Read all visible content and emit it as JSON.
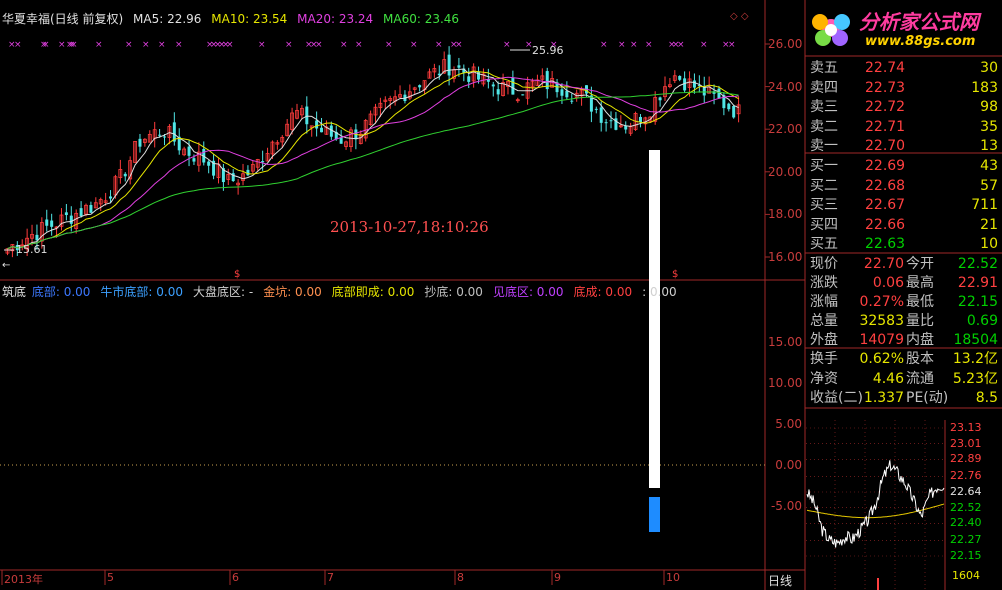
{
  "header": {
    "stock_name": "华夏幸福(日线 前复权)",
    "ma5": "MA5: 22.96",
    "ma10": "MA10: 23.54",
    "ma20": "MA20: 23.24",
    "ma60": "MA60: 23.46"
  },
  "logo": {
    "name": "分析家公式网",
    "url": "www.88gs.com"
  },
  "chart": {
    "y_ticks": [
      "26.00",
      "24.00",
      "22.00",
      "20.00",
      "18.00",
      "16.00"
    ],
    "high_label": "25.96",
    "low_label": "15.61",
    "watermark": "2013-10-27,18:10:26"
  },
  "indicator": {
    "name": "筑底",
    "items": [
      {
        "label": "底部: 0.00",
        "color": "#3c78ff"
      },
      {
        "label": "牛市底部: 0.00",
        "color": "#3ca0ff"
      },
      {
        "label": "大盘底区: -",
        "color": "#d0d0d0"
      },
      {
        "label": "金坑: 0.00",
        "color": "#ff9050"
      },
      {
        "label": "底部即成: 0.00",
        "color": "#e6e600"
      },
      {
        "label": "抄底: 0.00",
        "color": "#c0c0c0"
      },
      {
        "label": "见底区: 0.00",
        "color": "#c040ff"
      },
      {
        "label": "底成: 0.00",
        "color": "#ff4040"
      },
      {
        "label": ": 0.00",
        "color": "#d0d0d0"
      }
    ],
    "y_ticks": [
      "15.00",
      "10.00",
      "5.00",
      "0.00",
      "-5.00"
    ]
  },
  "date_axis": [
    "2013年",
    "5",
    "6",
    "7",
    "8",
    "9",
    "10"
  ],
  "period": "日线",
  "order_book": {
    "sell": [
      {
        "label": "卖五",
        "price": "22.74",
        "vol": "30"
      },
      {
        "label": "卖四",
        "price": "22.73",
        "vol": "183"
      },
      {
        "label": "卖三",
        "price": "22.72",
        "vol": "98"
      },
      {
        "label": "卖二",
        "price": "22.71",
        "vol": "35"
      },
      {
        "label": "卖一",
        "price": "22.70",
        "vol": "13"
      }
    ],
    "buy": [
      {
        "label": "买一",
        "price": "22.69",
        "vol": "43"
      },
      {
        "label": "买二",
        "price": "22.68",
        "vol": "57"
      },
      {
        "label": "买三",
        "price": "22.67",
        "vol": "711"
      },
      {
        "label": "买四",
        "price": "22.66",
        "vol": "21"
      },
      {
        "label": "买五",
        "price": "22.63",
        "vol": "10"
      }
    ]
  },
  "quote": [
    {
      "l1": "现价",
      "v1": "22.70",
      "c1": "#ff4040",
      "l2": "今开",
      "v2": "22.52",
      "c2": "#00d000"
    },
    {
      "l1": "涨跌",
      "v1": "0.06",
      "c1": "#ff4040",
      "l2": "最高",
      "v2": "22.91",
      "c2": "#ff4040"
    },
    {
      "l1": "涨幅",
      "v1": "0.27%",
      "c1": "#ff4040",
      "l2": "最低",
      "v2": "22.15",
      "c2": "#00d000"
    },
    {
      "l1": "总量",
      "v1": "32583",
      "c1": "#e6e600",
      "l2": "量比",
      "v2": "0.69",
      "c2": "#00d000"
    },
    {
      "l1": "外盘",
      "v1": "14079",
      "c1": "#ff4040",
      "l2": "内盘",
      "v2": "18504",
      "c2": "#00d000"
    },
    {
      "l1": "换手",
      "v1": "0.62%",
      "c1": "#e6e600",
      "l2": "股本",
      "v2": "13.2亿",
      "c2": "#e6e600"
    },
    {
      "l1": "净资",
      "v1": "4.46",
      "c1": "#e6e600",
      "l2": "流通",
      "v2": "5.23亿",
      "c2": "#e6e600"
    },
    {
      "l1": "收益(二)",
      "v1": "1.337",
      "c1": "#e6e600",
      "l2": "PE(动)",
      "v2": "8.5",
      "c2": "#e6e600"
    }
  ],
  "intraday": {
    "y_ticks": [
      "23.13",
      "23.01",
      "22.89",
      "22.76",
      "22.64",
      "22.52",
      "22.40",
      "22.27",
      "22.15"
    ],
    "volume_label": "1604"
  }
}
